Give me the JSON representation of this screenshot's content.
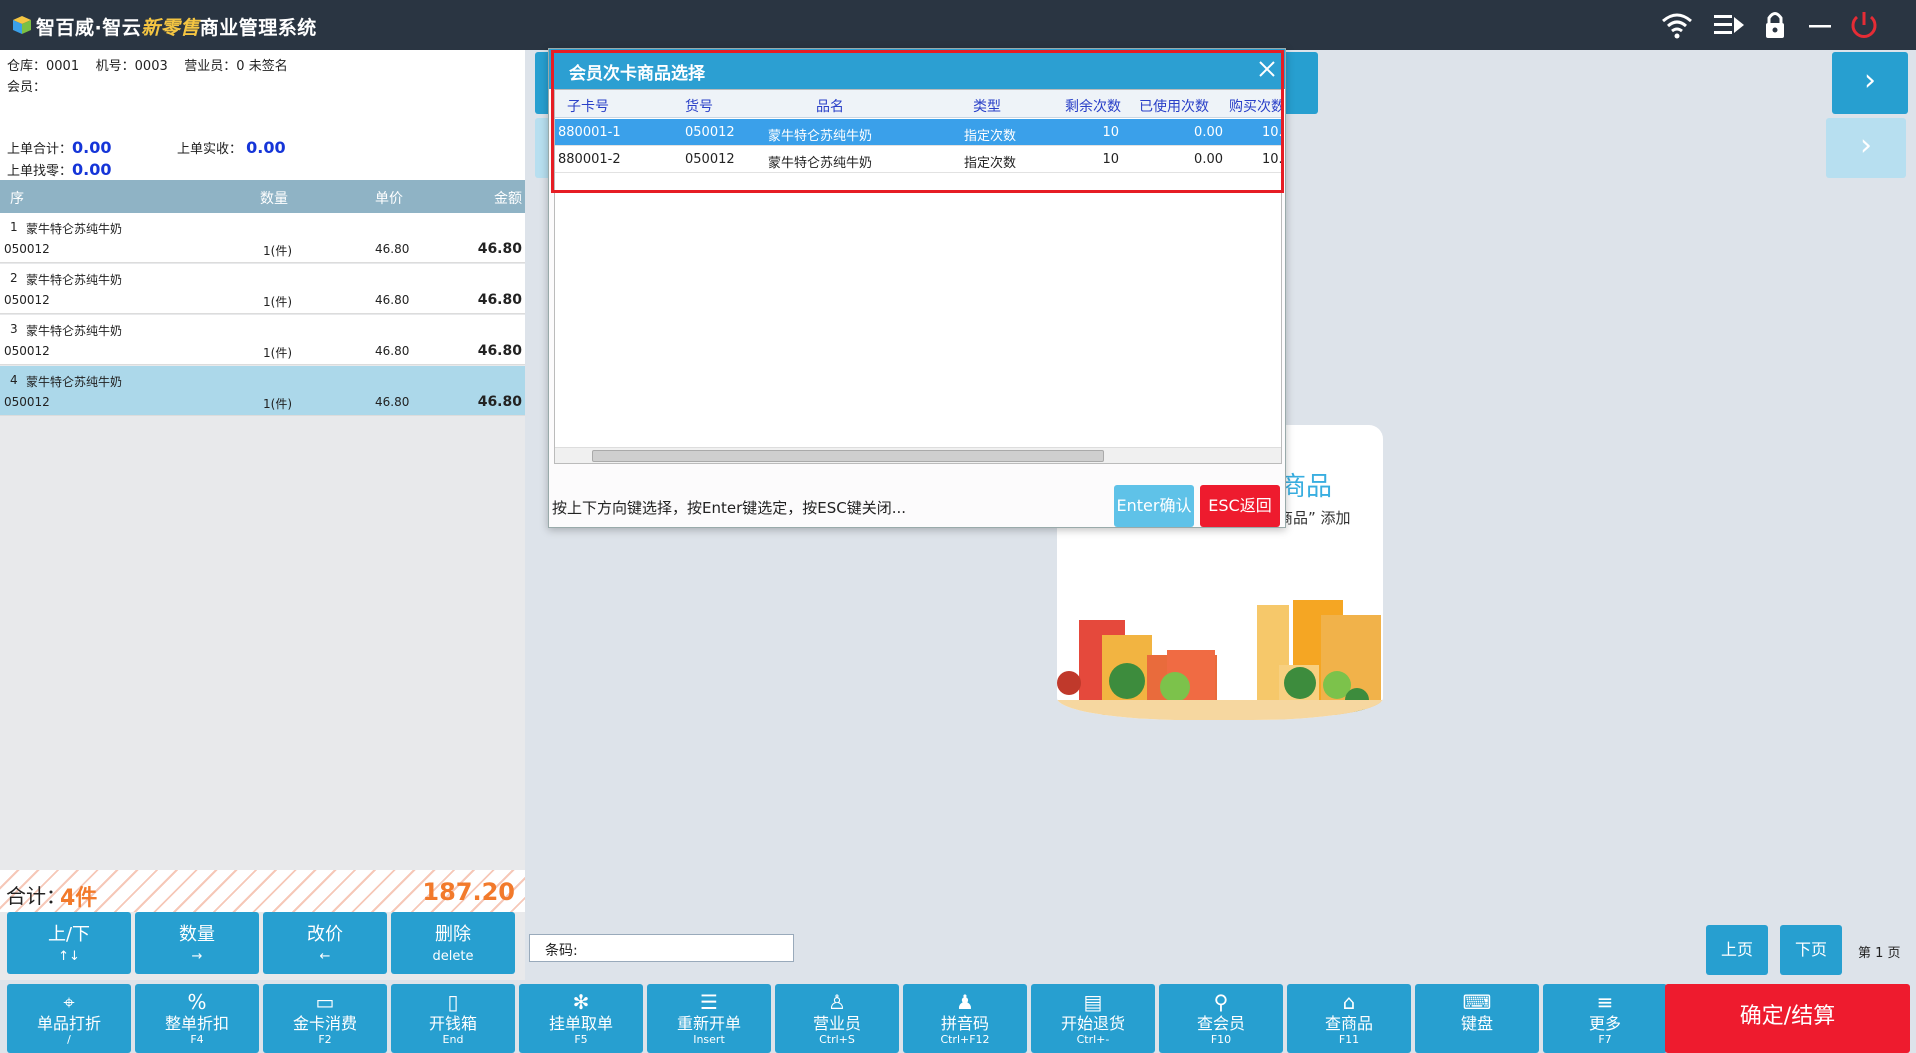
{
  "app": {
    "title_prefix": "智百威·智云",
    "title_script": "新零售",
    "title_suffix": "商业管理系统"
  },
  "info": {
    "warehouse_label": "仓库：",
    "warehouse": "0001",
    "machine_label": "机号：",
    "machine": "0003",
    "clerk_label": "营业员：",
    "clerk": "0 未签名",
    "member_label": "会员：",
    "member": "",
    "last_total_label": "上单合计：",
    "last_total": "0.00",
    "last_received_label": "上单实收：",
    "last_received": "0.00",
    "last_change_label": "上单找零：",
    "last_change": "0.00"
  },
  "order": {
    "headers": {
      "seq": "序",
      "qty": "数量",
      "price": "单价",
      "amount": "金额"
    },
    "rows": [
      {
        "seq": "1",
        "name": "蒙牛特仑苏纯牛奶",
        "code": "050012",
        "qty": "1(件)",
        "price": "46.80",
        "amount": "46.80"
      },
      {
        "seq": "2",
        "name": "蒙牛特仑苏纯牛奶",
        "code": "050012",
        "qty": "1(件)",
        "price": "46.80",
        "amount": "46.80"
      },
      {
        "seq": "3",
        "name": "蒙牛特仑苏纯牛奶",
        "code": "050012",
        "qty": "1(件)",
        "price": "46.80",
        "amount": "46.80"
      },
      {
        "seq": "4",
        "name": "蒙牛特仑苏纯牛奶",
        "code": "050012",
        "qty": "1(件)",
        "price": "46.80",
        "amount": "46.80"
      }
    ],
    "selected_index": 3,
    "total_label": "合计：",
    "total_count": "4件",
    "total_amount": "187.20"
  },
  "ops": [
    {
      "label": "上/下",
      "key": "↑↓"
    },
    {
      "label": "数量",
      "key": "→"
    },
    {
      "label": "改价",
      "key": "←"
    },
    {
      "label": "删除",
      "key": "delete"
    }
  ],
  "main": {
    "empty_title": "商品",
    "empty_sub": "商品” 添加",
    "barcode_label": "条码:",
    "prev_page": "上页",
    "next_page": "下页",
    "page_indicator": "第 1 页",
    "arrow": "›"
  },
  "functions": [
    {
      "label": "单品打折",
      "key": "/",
      "icon": "tag-icon"
    },
    {
      "label": "整单折扣",
      "key": "F4",
      "icon": "percent-icon"
    },
    {
      "label": "金卡消费",
      "key": "F2",
      "icon": "card-icon"
    },
    {
      "label": "开钱箱",
      "key": "End",
      "icon": "cashbox-icon"
    },
    {
      "label": "挂单取单",
      "key": "F5",
      "icon": "gear-icon"
    },
    {
      "label": "重新开单",
      "key": "Insert",
      "icon": "list-refresh-icon"
    },
    {
      "label": "营业员",
      "key": "Ctrl+S",
      "icon": "clerk-icon"
    },
    {
      "label": "拼音码",
      "key": "Ctrl+F12",
      "icon": "person-icon"
    },
    {
      "label": "开始退货",
      "key": "Ctrl+-",
      "icon": "clipboard-icon"
    },
    {
      "label": "查会员",
      "key": "F10",
      "icon": "member-search-icon"
    },
    {
      "label": "查商品",
      "key": "F11",
      "icon": "bag-icon"
    },
    {
      "label": "键盘",
      "key": "",
      "icon": "keyboard-icon"
    },
    {
      "label": "更多",
      "key": "F7",
      "icon": "menu-icon"
    }
  ],
  "checkout": "确定/结算",
  "dialog": {
    "title": "会员次卡商品选择",
    "columns": [
      "子卡号",
      "货号",
      "品名",
      "类型",
      "剩余次数",
      "已使用次数",
      "购买次数"
    ],
    "rows": [
      {
        "card": "880001-1",
        "code": "050012",
        "name": "蒙牛特仑苏纯牛奶",
        "type": "指定次数",
        "remaining": "10",
        "used": "0.00",
        "bought": "10."
      },
      {
        "card": "880001-2",
        "code": "050012",
        "name": "蒙牛特仑苏纯牛奶",
        "type": "指定次数",
        "remaining": "10",
        "used": "0.00",
        "bought": "10."
      }
    ],
    "selected_index": 0,
    "hint": "按上下方向键选择，按Enter键选定，按ESC键关闭...",
    "ok": "Enter确认",
    "esc": "ESC返回"
  },
  "colors": {
    "titlebar": "#2a3542",
    "accent": "#279fd0",
    "danger": "#ee1b2e",
    "highlight": "#e61d24",
    "total": "#f27a2b"
  }
}
